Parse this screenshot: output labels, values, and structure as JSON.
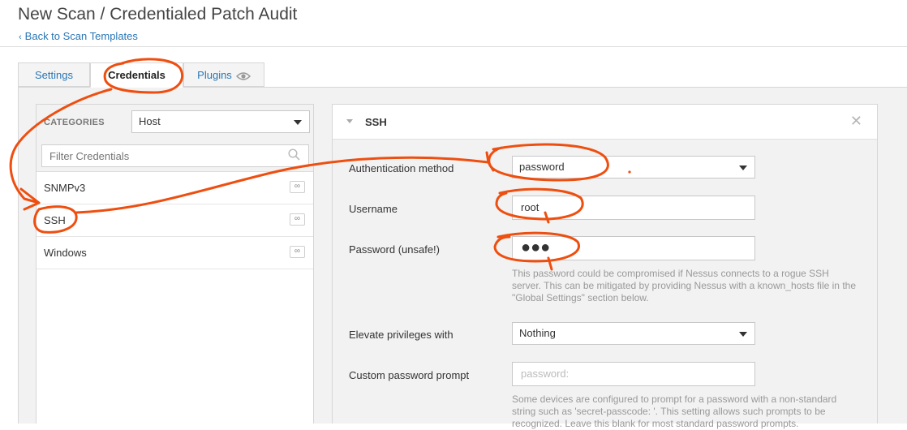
{
  "header": {
    "title": "New Scan / Credentialed Patch Audit",
    "back_link": "Back to Scan Templates"
  },
  "tabs": [
    {
      "label": "Settings"
    },
    {
      "label": "Credentials"
    },
    {
      "label": "Plugins"
    }
  ],
  "sidebar": {
    "categories_label": "CATEGORIES",
    "category_value": "Host",
    "filter_placeholder": "Filter Credentials",
    "items": [
      {
        "label": "SNMPv3",
        "badge": "∞"
      },
      {
        "label": "SSH",
        "badge": "∞"
      },
      {
        "label": "Windows",
        "badge": "∞"
      }
    ]
  },
  "ssh": {
    "title": "SSH",
    "auth_label": "Authentication method",
    "auth_value": "password",
    "username_label": "Username",
    "username_value": "root",
    "password_label": "Password (unsafe!)",
    "password_dots": "●●●",
    "password_help": "This password could be compromised if Nessus connects to a rogue SSH server. This can be mitigated by providing Nessus with a known_hosts file in the \"Global Settings\" section below.",
    "elevate_label": "Elevate privileges with",
    "elevate_value": "Nothing",
    "custom_prompt_label": "Custom password prompt",
    "custom_prompt_placeholder": "password:",
    "custom_prompt_help": "Some devices are configured to prompt for a password with a non-standard string such as 'secret-passcode: '. This setting allows such prompts to be recognized. Leave this blank for most standard password prompts."
  },
  "colors": {
    "link": "#2a76b4",
    "annotation": "#ee4f10"
  }
}
